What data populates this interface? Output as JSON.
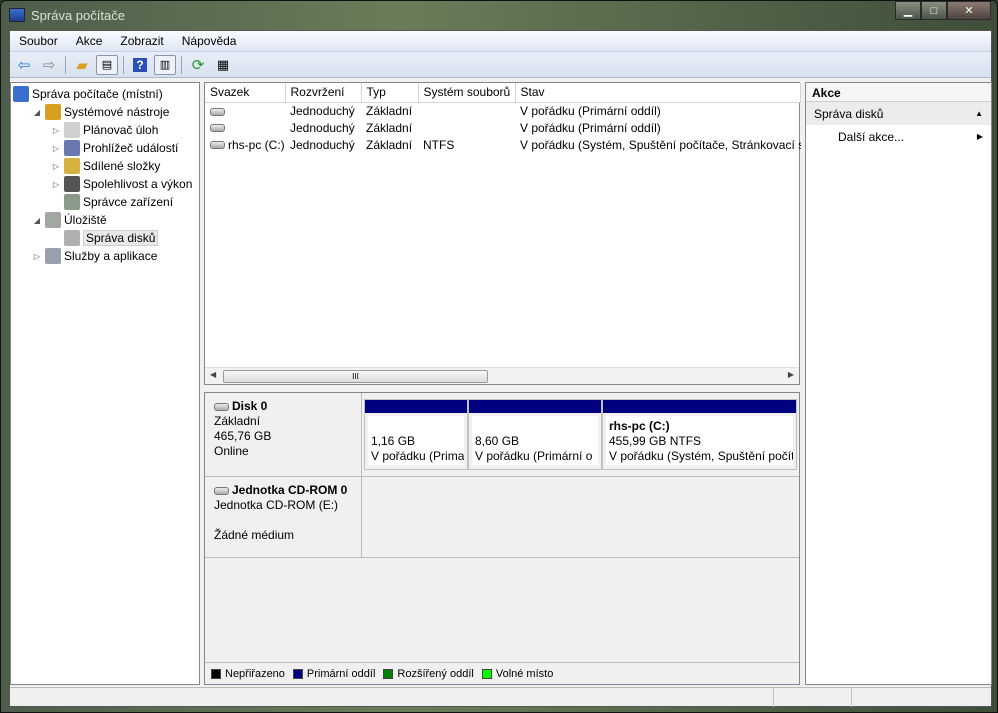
{
  "window": {
    "title": "Správa počítače",
    "controls": [
      "minimize",
      "maximize",
      "close"
    ]
  },
  "menu": [
    "Soubor",
    "Akce",
    "Zobrazit",
    "Nápověda"
  ],
  "toolbar": {
    "icons": [
      "back-icon",
      "forward-icon",
      "up-folder-icon",
      "show-hide-tree-icon",
      "help-icon",
      "show-hide-action-pane-icon",
      "refresh-icon",
      "properties-icon"
    ]
  },
  "tree": [
    {
      "label": "Správa počítače (místní)",
      "level": 0,
      "expander": "",
      "icon": "computer-icon"
    },
    {
      "label": "Systémové nástroje",
      "level": 1,
      "expander": "expanded",
      "icon": "tools-icon"
    },
    {
      "label": "Plánovač úloh",
      "level": 2,
      "expander": "collapsed",
      "icon": "clock-icon"
    },
    {
      "label": "Prohlížeč událostí",
      "level": 2,
      "expander": "collapsed",
      "icon": "event-viewer-icon"
    },
    {
      "label": "Sdílené složky",
      "level": 2,
      "expander": "collapsed",
      "icon": "shared-folder-icon"
    },
    {
      "label": "Spolehlivost a výkon",
      "level": 2,
      "expander": "collapsed",
      "icon": "performance-icon"
    },
    {
      "label": "Správce zařízení",
      "level": 2,
      "expander": "",
      "icon": "device-manager-icon"
    },
    {
      "label": "Úložiště",
      "level": 1,
      "expander": "expanded",
      "icon": "storage-icon"
    },
    {
      "label": "Správa disků",
      "level": 2,
      "expander": "",
      "icon": "disk-management-icon",
      "selected": true
    },
    {
      "label": "Služby a aplikace",
      "level": 1,
      "expander": "collapsed",
      "icon": "services-icon"
    }
  ],
  "volumes": {
    "columns": [
      "Svazek",
      "Rozvržení",
      "Typ",
      "Systém souborů",
      "Stav"
    ],
    "rows": [
      [
        "",
        "Jednoduchý",
        "Základní",
        "",
        "V pořádku (Primární oddíl)"
      ],
      [
        "",
        "Jednoduchý",
        "Základní",
        "",
        "V pořádku (Primární oddíl)"
      ],
      [
        "rhs-pc (C:)",
        "Jednoduchý",
        "Základní",
        "NTFS",
        "V pořádku (Systém, Spuštění počítače, Stránkovací soubor, Aktivní, Výpis stavu systému, Primární oddíl)"
      ]
    ],
    "scroll_thumb": "III"
  },
  "disks": [
    {
      "name": "Disk 0",
      "lines": [
        "Základní",
        "465,76 GB",
        "Online"
      ],
      "partitions": [
        {
          "name": "",
          "size": "1,16 GB",
          "status": "V pořádku (Prima"
        },
        {
          "name": "",
          "size": "8,60 GB",
          "status": "V pořádku (Primární o"
        },
        {
          "name": "rhs-pc  (C:)",
          "size": "455,99 GB NTFS",
          "status": "V pořádku (Systém, Spuštění počít"
        }
      ]
    },
    {
      "name": "Jednotka CD-ROM 0",
      "lines": [
        "Jednotka CD-ROM (E:)",
        "",
        "Žádné médium"
      ]
    }
  ],
  "legend": [
    {
      "label": "Nepřiřazeno",
      "color": "#000000"
    },
    {
      "label": "Primární oddíl",
      "color": "#000080"
    },
    {
      "label": "Rozšířený oddíl",
      "color": "#008000"
    },
    {
      "label": "Volné místo",
      "color": "#00ff00"
    }
  ],
  "actions": {
    "title": "Akce",
    "section": "Správa disků",
    "items": [
      "Další akce..."
    ]
  }
}
